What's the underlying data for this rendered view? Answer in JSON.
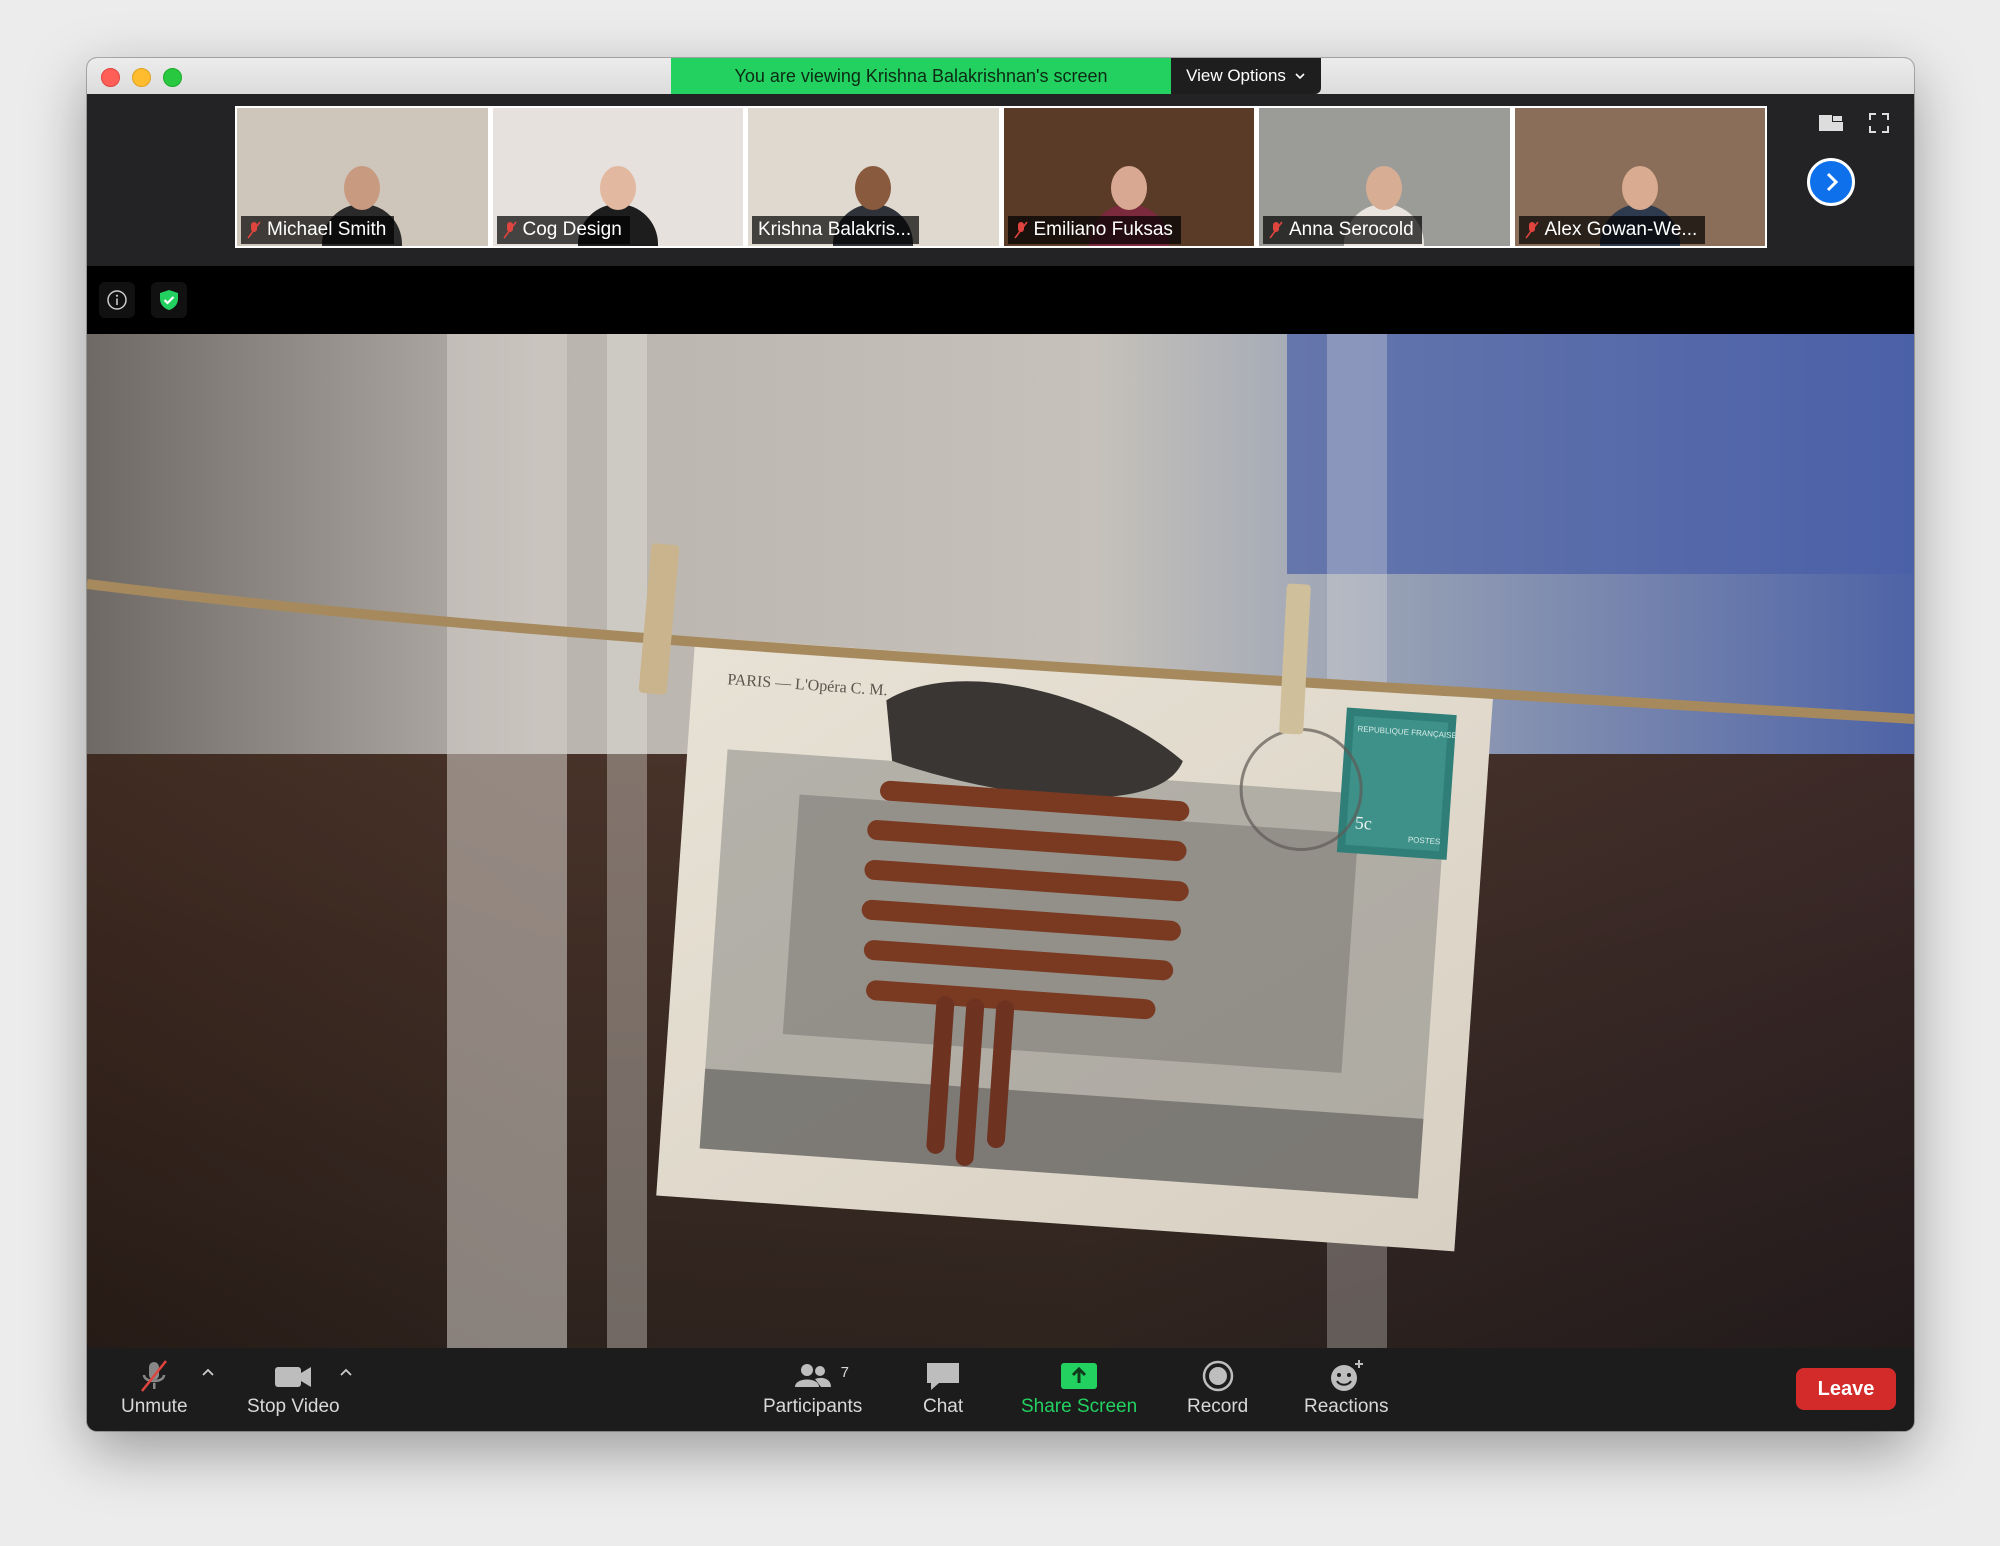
{
  "banner": {
    "viewing_text": "You are viewing Krishna Balakrishnan's screen",
    "view_options_label": "View Options"
  },
  "participants_strip": [
    {
      "name": "Michael Smith",
      "muted": true,
      "active": false,
      "bg": "#cfc6bb",
      "shirt": "#2a2a2a",
      "skin": "#c89a80"
    },
    {
      "name": "Cog Design",
      "muted": true,
      "active": false,
      "bg": "#e6e1dc",
      "shirt": "#1d1d1d",
      "skin": "#e3b8a0"
    },
    {
      "name": "Krishna Balakris...",
      "muted": false,
      "active": true,
      "bg": "#dfd9cf",
      "shirt": "#2f3339",
      "skin": "#8a5a3e"
    },
    {
      "name": "Emiliano Fuksas",
      "muted": true,
      "active": false,
      "bg": "#5a3b28",
      "shirt": "#7a2a3c",
      "skin": "#d8a892"
    },
    {
      "name": "Anna Serocold",
      "muted": true,
      "active": false,
      "bg": "#9b9b97",
      "shirt": "#e9e5de",
      "skin": "#d7ad94"
    },
    {
      "name": "Alex Gowan-We...",
      "muted": true,
      "active": false,
      "bg": "#8b6e59",
      "shirt": "#2e3a4e",
      "skin": "#d9ab90"
    }
  ],
  "toolbar": {
    "unmute_label": "Unmute",
    "stop_video_label": "Stop Video",
    "participants_label": "Participants",
    "participants_count": "7",
    "chat_label": "Chat",
    "share_screen_label": "Share Screen",
    "record_label": "Record",
    "reactions_label": "Reactions",
    "leave_label": "Leave"
  },
  "shared_content": {
    "postcard_caption": "PARIS — L'Opéra   C. M.",
    "stamp_text": "REPUBLIQUE FRANÇAISE",
    "stamp_value": "5c",
    "stamp_footer": "POSTES"
  },
  "colors": {
    "accent_green": "#23d160",
    "leave_red": "#d32a2a",
    "next_blue": "#0e71eb"
  }
}
